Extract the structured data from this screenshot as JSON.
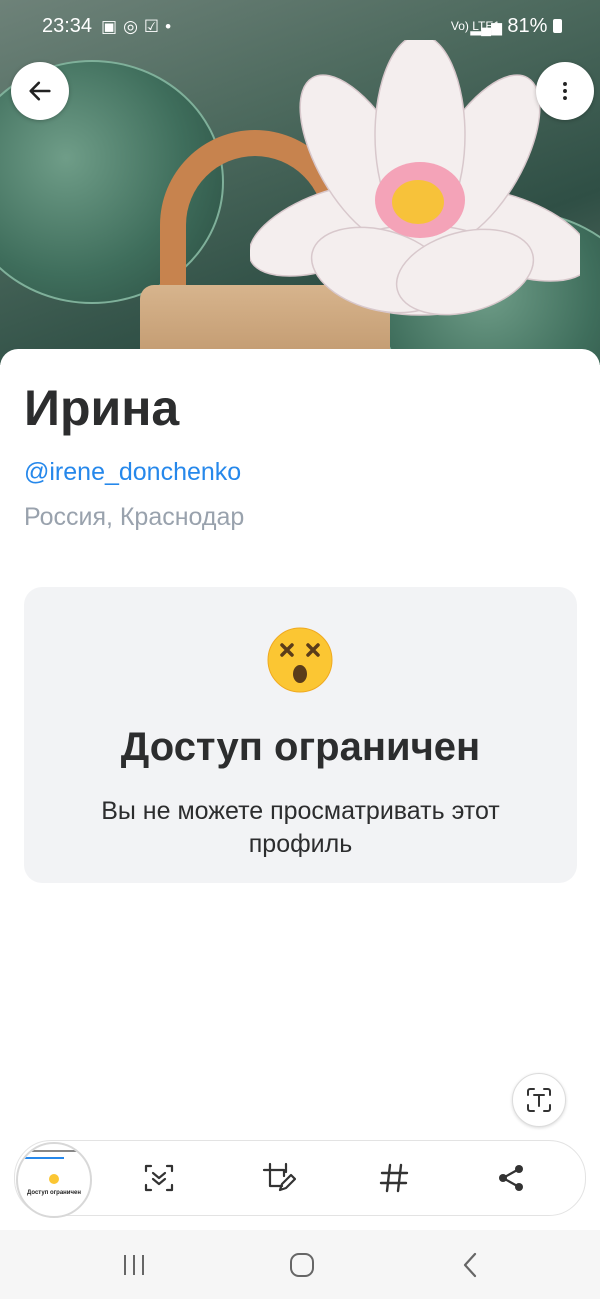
{
  "status_bar": {
    "time": "23:34",
    "notification_icons": [
      "gallery-icon",
      "whatsapp-icon",
      "checkbox-icon",
      "dot-icon"
    ],
    "network": "Vo) LTE1",
    "battery": "81%"
  },
  "profile": {
    "name": "Ирина",
    "handle": "@irene_donchenko",
    "location": "Россия, Краснодар"
  },
  "restricted": {
    "emoji": "dizzy-face-emoji",
    "title": "Доступ ограничен",
    "text": "Вы не можете просматривать этот профиль"
  },
  "toolbar": {
    "thumbnail_title": "Доступ ограничен",
    "actions": [
      "scroll-capture-icon",
      "edit-crop-icon",
      "hashtag-icon",
      "share-icon"
    ]
  },
  "colors": {
    "link": "#2688eb",
    "secondary": "#99a2ad",
    "text": "#2c2d2e",
    "card_bg": "#f2f3f5"
  }
}
